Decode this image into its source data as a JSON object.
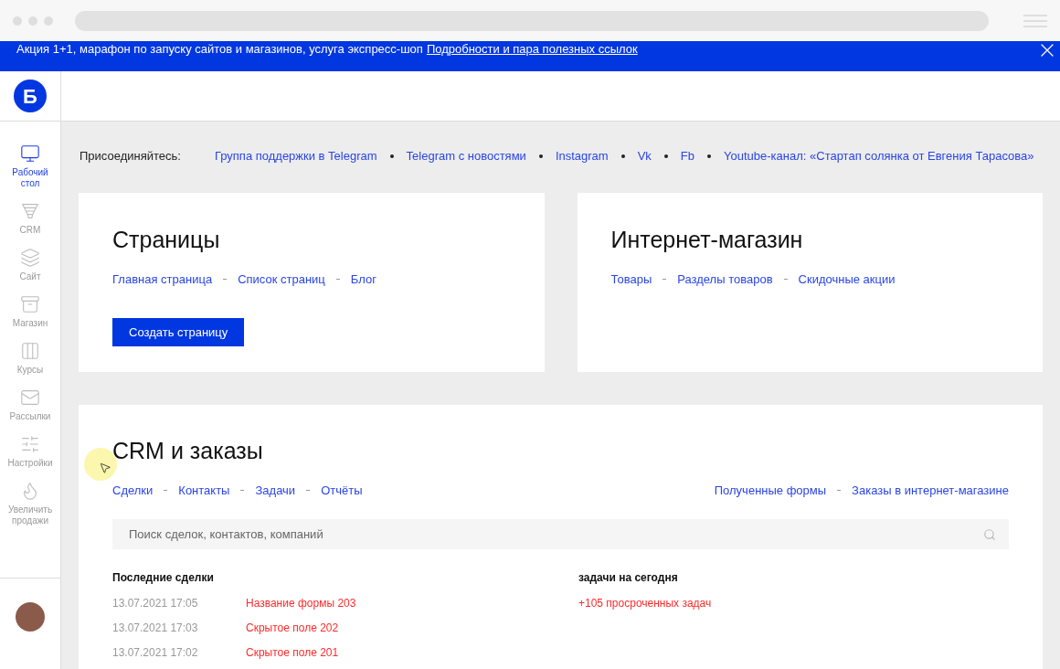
{
  "banner": {
    "text": "Акция 1+1, марафон по запуску сайтов и магазинов, услуга экспресс-шоп",
    "link": "Подробности и пара полезных ссылок"
  },
  "logo": {
    "letter": "Б"
  },
  "sidebar": {
    "items": [
      {
        "label": "Рабочий стол",
        "kind": "desktop",
        "selected": true
      },
      {
        "label": "CRM",
        "kind": "crm",
        "selected": false
      },
      {
        "label": "Сайт",
        "kind": "site",
        "selected": false
      },
      {
        "label": "Магазин",
        "kind": "shop",
        "selected": false
      },
      {
        "label": "Курсы",
        "kind": "courses",
        "selected": false
      },
      {
        "label": "Рассылки",
        "kind": "mail",
        "selected": false
      },
      {
        "label": "Настройки",
        "kind": "settings",
        "selected": false
      },
      {
        "label": "Увеличить продажи",
        "kind": "sales",
        "selected": false
      }
    ]
  },
  "join": {
    "label": "Присоединяйтесь:",
    "links": [
      "Группа поддержки в Telegram",
      "Telegram с новостями",
      "Instagram",
      "Vk",
      "Fb",
      "Youtube-канал: «Стартап солянка от Евгения Тарасова»"
    ]
  },
  "pages_card": {
    "title": "Страницы",
    "links": [
      "Главная страница",
      "Список страниц",
      "Блог"
    ],
    "button": "Создать страницу"
  },
  "shop_card": {
    "title": "Интернет-магазин",
    "links": [
      "Товары",
      "Разделы товаров",
      "Скидочные акции"
    ]
  },
  "crm_card": {
    "title": "CRM и заказы",
    "links_left": [
      "Сделки",
      "Контакты",
      "Задачи",
      "Отчёты"
    ],
    "links_right": [
      "Полученные формы",
      "Заказы в интернет-магазине"
    ],
    "search": {
      "placeholder": "Поиск сделок, контактов, компаний"
    },
    "deals": {
      "heading": "Последние сделки",
      "rows": [
        {
          "date": "13.07.2021 17:05",
          "name": "Название формы 203"
        },
        {
          "date": "13.07.2021 17:03",
          "name": "Скрытое поле 202"
        },
        {
          "date": "13.07.2021 17:02",
          "name": "Скрытое поле 201"
        }
      ]
    },
    "tasks": {
      "heading": "задачи на сегодня",
      "items": [
        "+105 просроченных задач"
      ]
    }
  }
}
